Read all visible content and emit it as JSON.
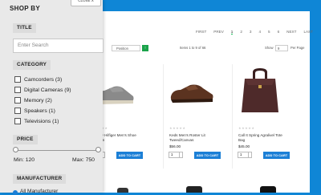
{
  "sidebar": {
    "close_label": "CLOSE X",
    "shop_by": "SHOP BY",
    "title_heading": "TITLE",
    "search_placeholder": "Enter Search",
    "category_heading": "CATEGORY",
    "categories": [
      {
        "label": "Camcorders (3)"
      },
      {
        "label": "Digital Cameras (9)"
      },
      {
        "label": "Memory (2)"
      },
      {
        "label": "Speakers (1)"
      },
      {
        "label": "Televisions (1)"
      }
    ],
    "price_heading": "PRICE",
    "price_min": "Min: 120",
    "price_max": "Max: 750",
    "manufacturer_heading": "MANUFACTURER",
    "manufacturer_option": "All Manufacturer"
  },
  "pager": {
    "first": "FIRST",
    "prev": "PREV",
    "pages": [
      "1",
      "2",
      "3",
      "4",
      "5",
      "6"
    ],
    "current": "1",
    "next": "NEXT",
    "last": "LAST"
  },
  "sortbar": {
    "sort_value": "Position",
    "items_text": "Items 1 to 9 of 66",
    "show_label": "Show",
    "show_value": "9",
    "per_page": "Per Page"
  },
  "products": [
    {
      "name": "Tommy Hilfiger Men's Shoe Fashion",
      "price": "",
      "add": "ADD TO CART",
      "qty": "1"
    },
    {
      "name": "Keds Men's Roster Lit Tweed/Canvas",
      "price": "$56.00",
      "add": "ADD TO CART",
      "qty": "1"
    },
    {
      "name": "Call It Spring Agralivel Tote Bag",
      "price": "$45.00",
      "add": "ADD TO CART",
      "qty": "1"
    }
  ],
  "colors": {
    "accent": "#1b7fd6",
    "background": "#0f86d6",
    "sort_button": "#1aa34a"
  }
}
